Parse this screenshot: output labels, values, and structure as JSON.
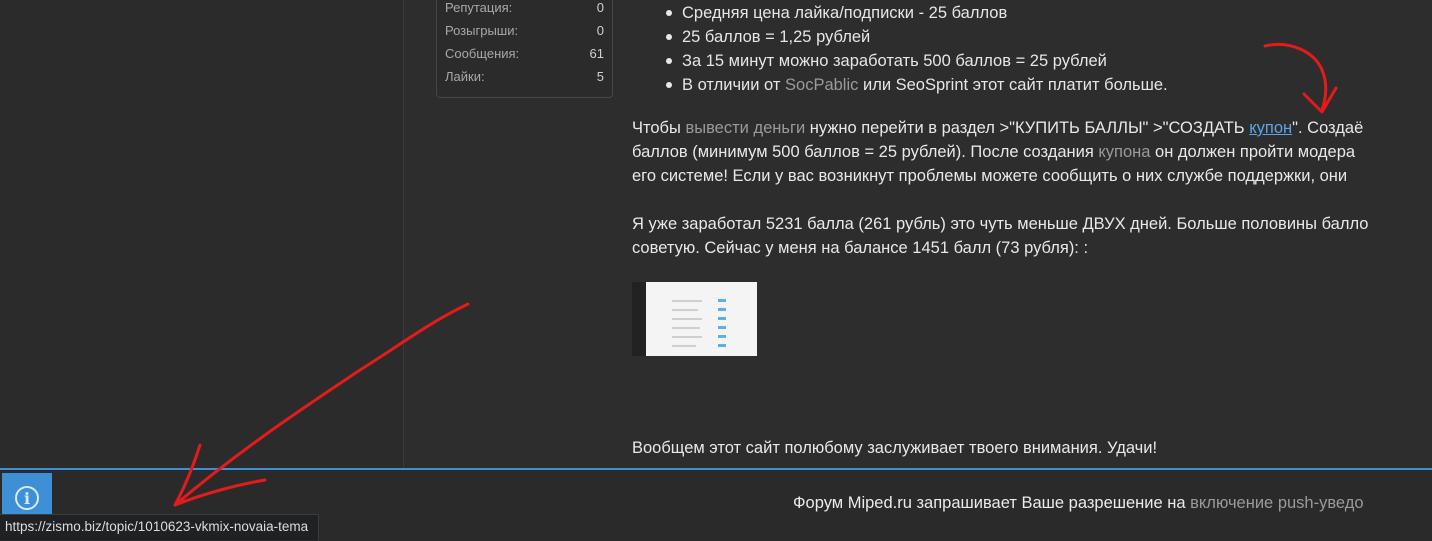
{
  "user_stats": [
    {
      "label": "Репутация:",
      "value": "0"
    },
    {
      "label": "Розыгрыши:",
      "value": "0"
    },
    {
      "label": "Сообщения:",
      "value": "61"
    },
    {
      "label": "Лайки:",
      "value": "5"
    }
  ],
  "post": {
    "bullets": [
      "Средняя цена лайка/подписки - 25 баллов",
      "25 баллов = 1,25 рублей",
      "За 15 минут можно заработать 500 баллов = 25 рублей"
    ],
    "bullet4": {
      "before": "В отличии от ",
      "link1": "SocPablic",
      "middle": " или SeoSprint этот сайт платит больше."
    },
    "para1_line1": {
      "t1": "Чтобы ",
      "link1": "вывести деньги",
      "t2": " нужно перейти в раздел >\"КУПИТЬ БАЛЛЫ\" >\"СОЗДАТЬ ",
      "link2": "купон",
      "t3": "\". Создаё"
    },
    "para1_line2": {
      "t1": "баллов (минимум 500 баллов = 25 рублей). После создания ",
      "link1": "купона",
      "t2": " он должен пройти модера"
    },
    "para1_line3": "его системе! Если у вас возникнут проблемы можете сообщить о них службе поддержки, они",
    "para2_line1": "Я уже заработал 5231 балла (261 рубль) это чуть меньше ДВУХ дней. Больше половины балло",
    "para2_line2": "советую. Сейчас у меня на балансе 1451 балл (73 рубля): :",
    "closing": "Вообщем этот сайт полюбому заслуживает твоего внимания. Удачи!"
  },
  "push_prompt": {
    "text": "Форум Miped.ru запрашивает Ваше разрешение на ",
    "muted": "включение push-уведо"
  },
  "status_bar": {
    "url": "https://zismo.biz/topic/1010623-vkmix-novaia-tema"
  },
  "colors": {
    "accent": "#3d8fd6",
    "link": "#5aa6ea",
    "annotation": "#e31b1b"
  },
  "icons": [
    "info-icon"
  ]
}
